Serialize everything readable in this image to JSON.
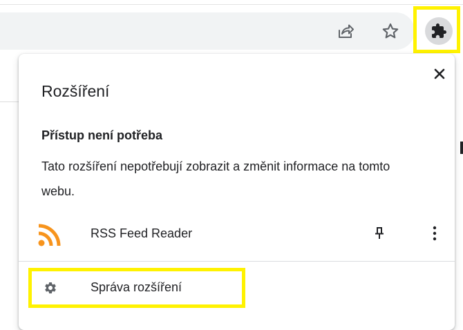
{
  "toolbar": {
    "share_icon": "share-icon",
    "bookmark_icon": "star-icon",
    "extensions_icon": "puzzle-icon"
  },
  "popup": {
    "title": "Rozšíření",
    "close_icon": "close-icon",
    "section": {
      "heading": "Přístup není potřeba",
      "description": "Tato rozšíření nepotřebují zobrazit a změnit informace na tomto webu."
    },
    "extensions": [
      {
        "name": "RSS Feed Reader",
        "icon": "rss-icon",
        "icon_color": "#f7941d",
        "pin_icon": "pin-icon",
        "more_icon": "more-vert-icon"
      }
    ],
    "manage": {
      "label": "Správa rozšíření",
      "icon": "gear-icon"
    }
  },
  "colors": {
    "highlight": "#fff200",
    "text": "#202124",
    "icon": "#5f6368"
  }
}
